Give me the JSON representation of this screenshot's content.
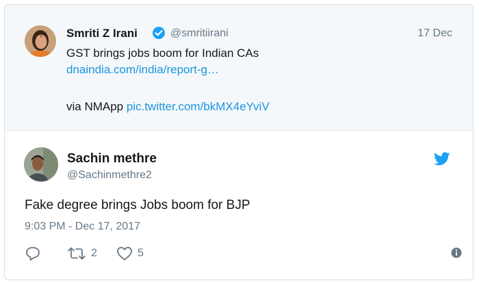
{
  "quoted_tweet": {
    "name": "Smriti Z Irani",
    "handle": "@smritiirani",
    "date": "17 Dec",
    "text": "GST brings jobs boom for Indian CAs",
    "link": "dnaindia.com/india/report-g…",
    "via_prefix": "via NMApp ",
    "via_link": "pic.twitter.com/bkMX4eYviV"
  },
  "reply_tweet": {
    "name": "Sachin methre",
    "handle": "@Sachinmethre2",
    "text": "Fake degree brings Jobs boom for BJP",
    "timestamp": "9:03 PM - Dec 17, 2017"
  },
  "actions": {
    "retweet_count": "2",
    "like_count": "5"
  },
  "colors": {
    "link": "#1b95e0",
    "muted": "#657786",
    "verified": "#1da1f2",
    "twitter_bird": "#1da1f2"
  },
  "icons": [
    "verified-badge-icon",
    "twitter-bird-icon",
    "reply-icon",
    "retweet-icon",
    "like-icon",
    "info-icon"
  ]
}
